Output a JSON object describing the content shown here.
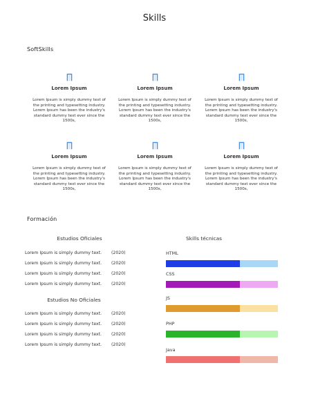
{
  "page": {
    "title": "Skills"
  },
  "softskills": {
    "heading": "SoftSkills",
    "cards": [
      {
        "icon": "bookmark-icon",
        "title": "Lorem Ipsum",
        "text": "Lorem Ipsum is simply dummy text of the printing and typesetting industry. Lorem Ipsum has been the industry's standard dummy text ever since the 1500s,"
      },
      {
        "icon": "bookmark-icon",
        "title": "Lorem Ipsum",
        "text": "Lorem Ipsum is simply dummy text of the printing and typesetting industry. Lorem Ipsum has been the industry's standard dummy text ever since the 1500s,"
      },
      {
        "icon": "bookmark-icon",
        "title": "Lorem Ipsum",
        "text": "Lorem Ipsum is simply dummy text of the printing and typesetting industry. Lorem Ipsum has been the industry's standard dummy text ever since the 1500s,"
      },
      {
        "icon": "bookmark-icon",
        "title": "Lorem Ipsum",
        "text": "Lorem Ipsum is simply dummy text of the printing and typesetting industry. Lorem Ipsum has been the industry's standard dummy text ever since the 1500s,"
      },
      {
        "icon": "bookmark-icon",
        "title": "Lorem Ipsum",
        "text": "Lorem Ipsum is simply dummy text of the printing and typesetting industry. Lorem Ipsum has been the industry's standard dummy text ever since the 1500s,"
      },
      {
        "icon": "bookmark-icon",
        "title": "Lorem Ipsum",
        "text": "Lorem Ipsum is simply dummy text of the printing and typesetting industry. Lorem Ipsum has been the industry's standard dummy text ever since the 1500s,"
      }
    ]
  },
  "formacion": {
    "heading": "Formación",
    "oficiales": {
      "heading": "Estudios Oficiales",
      "rows": [
        {
          "text": "Lorem Ipsum is simply dummy text.",
          "year": "(2020)"
        },
        {
          "text": "Lorem Ipsum is simply dummy text.",
          "year": "(2020)"
        },
        {
          "text": "Lorem Ipsum is simply dummy text.",
          "year": "(2020)"
        },
        {
          "text": "Lorem Ipsum is simply dummy text.",
          "year": "(2020)"
        }
      ]
    },
    "no_oficiales": {
      "heading": "Estudios No Oficiales",
      "rows": [
        {
          "text": "Lorem Ipsum is simply dummy text.",
          "year": "(2020)"
        },
        {
          "text": "Lorem Ipsum is simply dummy text.",
          "year": "(2020)"
        },
        {
          "text": "Lorem Ipsum is simply dummy text.",
          "year": "(2020)"
        },
        {
          "text": "Lorem Ipsum is simply dummy text.",
          "year": "(2020)"
        }
      ]
    }
  },
  "skills": {
    "heading": "Skills técnicas",
    "items": [
      {
        "name": "HTML",
        "level": 0.66,
        "color": "#1f3de6",
        "track_color": "#a8d8f6"
      },
      {
        "name": "CSS",
        "level": 0.66,
        "color": "#a319b8",
        "track_color": "#edaaf2"
      },
      {
        "name": "JS",
        "level": 0.66,
        "color": "#e09b2e",
        "track_color": "#fbe0a4"
      },
      {
        "name": "PHP",
        "level": 0.66,
        "color": "#2bb32b",
        "track_color": "#b8f5b0"
      },
      {
        "name": "Java",
        "level": 0.66,
        "color": "#f0716f",
        "track_color": "#f0b8a8"
      }
    ]
  },
  "colors": {
    "icon": "#4a90e2",
    "text": "#333333"
  }
}
